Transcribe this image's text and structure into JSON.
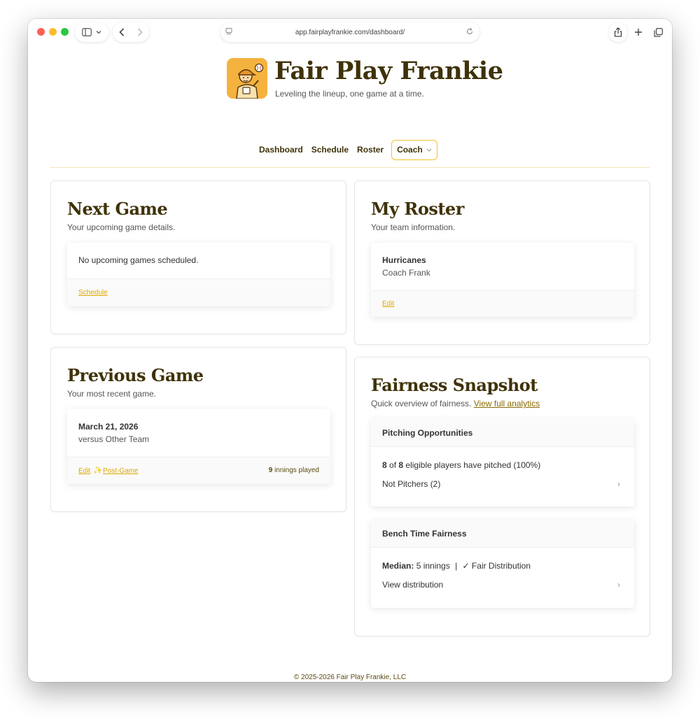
{
  "browser": {
    "url": "app.fairplayfrankie.com/dashboard/"
  },
  "brand": {
    "name": "Fair Play Frankie",
    "tagline": "Leveling the lineup, one game at a time."
  },
  "nav": {
    "dashboard": "Dashboard",
    "schedule": "Schedule",
    "roster": "Roster",
    "coach": "Coach"
  },
  "next_game": {
    "title": "Next Game",
    "subtitle": "Your upcoming game details.",
    "message": "No upcoming games scheduled.",
    "schedule_link": "Schedule"
  },
  "previous_game": {
    "title": "Previous Game",
    "subtitle": "Your most recent game.",
    "date": "March 21, 2026",
    "opponent": "versus Other Team",
    "edit_link": "Edit",
    "post_game_link": "Post-Game",
    "innings_count": "9",
    "innings_label": "innings played"
  },
  "my_roster": {
    "title": "My Roster",
    "subtitle": "Your team information.",
    "team_name": "Hurricanes",
    "coach_name": "Coach Frank",
    "edit_link": "Edit"
  },
  "fairness": {
    "title": "Fairness Snapshot",
    "subtitle": "Quick overview of fairness.",
    "analytics_link": "View full analytics",
    "pitching": {
      "header": "Pitching Opportunities",
      "pitched": "8",
      "of_word": "of",
      "eligible": "8",
      "summary_rest": "eligible players have pitched (100%)",
      "not_pitchers": "Not Pitchers (2)"
    },
    "bench": {
      "header": "Bench Time Fairness",
      "median_label": "Median:",
      "median_value": "5 innings",
      "separator": "|",
      "status": "✓ Fair Distribution",
      "view_distribution": "View distribution"
    }
  },
  "footer": {
    "copyright": "© 2025-2026 Fair Play Frankie, LLC"
  }
}
